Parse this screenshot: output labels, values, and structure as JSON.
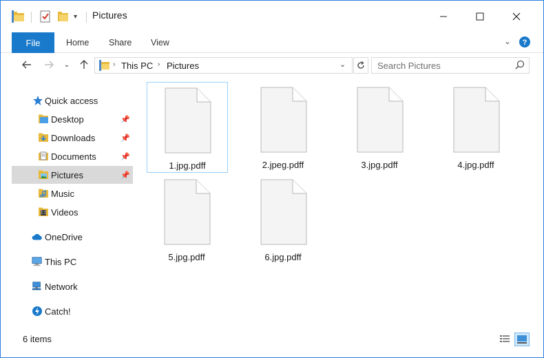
{
  "window": {
    "title": "Pictures",
    "controls": {
      "minimize": "—",
      "maximize": "☐",
      "close": "✕"
    }
  },
  "ribbon": {
    "tabs": [
      "File",
      "Home",
      "Share",
      "View"
    ]
  },
  "address": {
    "crumbs": [
      "This PC",
      "Pictures"
    ],
    "separator": ">"
  },
  "search": {
    "placeholder": "Search Pictures"
  },
  "nav": {
    "items": [
      {
        "label": "Quick access",
        "icon": "star-icon",
        "pinned": false
      },
      {
        "label": "Desktop",
        "icon": "folder-icon",
        "pinned": true
      },
      {
        "label": "Downloads",
        "icon": "downloads-folder-icon",
        "pinned": true
      },
      {
        "label": "Documents",
        "icon": "documents-folder-icon",
        "pinned": true
      },
      {
        "label": "Pictures",
        "icon": "pictures-folder-icon",
        "pinned": true,
        "selected": true
      },
      {
        "label": "Music",
        "icon": "music-folder-icon",
        "pinned": false
      },
      {
        "label": "Videos",
        "icon": "videos-folder-icon",
        "pinned": false
      },
      {
        "label": "OneDrive",
        "icon": "cloud-icon",
        "pinned": false
      },
      {
        "label": "This PC",
        "icon": "computer-icon",
        "pinned": false
      },
      {
        "label": "Network",
        "icon": "network-icon",
        "pinned": false
      },
      {
        "label": "Catch!",
        "icon": "catch-icon",
        "pinned": false
      }
    ]
  },
  "files": [
    {
      "name": "1.jpg.pdff"
    },
    {
      "name": "2.jpeg.pdff"
    },
    {
      "name": "3.jpg.pdff"
    },
    {
      "name": "4.jpg.pdff"
    },
    {
      "name": "5.jpg.pdff"
    },
    {
      "name": "6.jpg.pdff"
    }
  ],
  "status": {
    "count_text": "6 items"
  },
  "colors": {
    "accent": "#1979ca",
    "selection": "#d9d9d9",
    "border": "#2b7de0"
  }
}
